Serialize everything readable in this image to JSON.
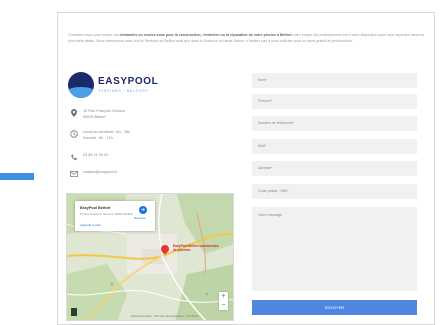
{
  "intro": {
    "part1": "Contactez nous pour toutes vos ",
    "bold1": "demandes ou rendez-vous pour la construction, l'entretien ou la réparation de votre piscine à Belfort",
    "part2": " notre équipe de professionnels est à votre disposition pour vous répondre dans les plus brefs délais. Nous intervenons dans tout le Territoire de Belfort ainsi que dans le Doubs et la Haute-Saône, n'hésitez pas à nous solliciter pour un devis gratuit et personnalisé."
  },
  "brand": {
    "name": "EASYPOOL",
    "tagline": "PISCINES · BELFORT"
  },
  "contact": {
    "address_line1": "10 Rue François Genoux",
    "address_line2": "90000 Belfort",
    "hours_line1": "Lundi au vendredi : 8h - 18h",
    "hours_line2": "Samedi : 8h - 12h",
    "phone": "03 84 21 00 00",
    "email": "contact@easypool.fr"
  },
  "map": {
    "card_place": "EasyPool Belfort",
    "card_address": "10 Rue François Genoux, 90000 Belfort",
    "card_link": "Agrandir le plan",
    "card_directions": "Itinéraire",
    "pin_label": "EasyPool Belfort construction de piscines",
    "footer": "Raccourcis clavier · Données cartographiques · Conditions"
  },
  "form": {
    "nom_placeholder": "Nom*",
    "prenom_placeholder": "Prénom*",
    "phone_placeholder": "Numéro de téléphone*",
    "email_placeholder": "Mail*",
    "address_placeholder": "Adresse*",
    "postal_placeholder": "Code postal - Ville*",
    "message_placeholder": "Votre message",
    "submit_label": "ENVOYER"
  },
  "colors": {
    "accent": "#3d8fe0",
    "brand_dark": "#1b2a6b",
    "submit": "#4f87e0"
  },
  "icons": [
    "map-pin-icon",
    "clock-icon",
    "phone-icon",
    "email-icon"
  ]
}
